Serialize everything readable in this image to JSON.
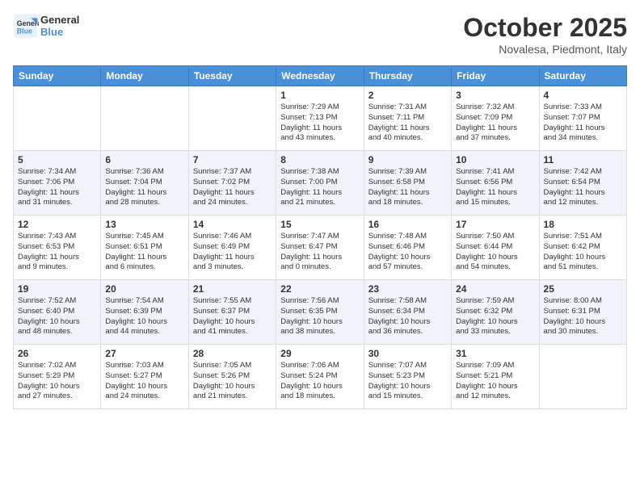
{
  "header": {
    "logo_line1": "General",
    "logo_line2": "Blue",
    "month": "October 2025",
    "location": "Novalesa, Piedmont, Italy"
  },
  "days_of_week": [
    "Sunday",
    "Monday",
    "Tuesday",
    "Wednesday",
    "Thursday",
    "Friday",
    "Saturday"
  ],
  "weeks": [
    [
      {
        "day": "",
        "info": ""
      },
      {
        "day": "",
        "info": ""
      },
      {
        "day": "",
        "info": ""
      },
      {
        "day": "1",
        "info": "Sunrise: 7:29 AM\nSunset: 7:13 PM\nDaylight: 11 hours\nand 43 minutes."
      },
      {
        "day": "2",
        "info": "Sunrise: 7:31 AM\nSunset: 7:11 PM\nDaylight: 11 hours\nand 40 minutes."
      },
      {
        "day": "3",
        "info": "Sunrise: 7:32 AM\nSunset: 7:09 PM\nDaylight: 11 hours\nand 37 minutes."
      },
      {
        "day": "4",
        "info": "Sunrise: 7:33 AM\nSunset: 7:07 PM\nDaylight: 11 hours\nand 34 minutes."
      }
    ],
    [
      {
        "day": "5",
        "info": "Sunrise: 7:34 AM\nSunset: 7:06 PM\nDaylight: 11 hours\nand 31 minutes."
      },
      {
        "day": "6",
        "info": "Sunrise: 7:36 AM\nSunset: 7:04 PM\nDaylight: 11 hours\nand 28 minutes."
      },
      {
        "day": "7",
        "info": "Sunrise: 7:37 AM\nSunset: 7:02 PM\nDaylight: 11 hours\nand 24 minutes."
      },
      {
        "day": "8",
        "info": "Sunrise: 7:38 AM\nSunset: 7:00 PM\nDaylight: 11 hours\nand 21 minutes."
      },
      {
        "day": "9",
        "info": "Sunrise: 7:39 AM\nSunset: 6:58 PM\nDaylight: 11 hours\nand 18 minutes."
      },
      {
        "day": "10",
        "info": "Sunrise: 7:41 AM\nSunset: 6:56 PM\nDaylight: 11 hours\nand 15 minutes."
      },
      {
        "day": "11",
        "info": "Sunrise: 7:42 AM\nSunset: 6:54 PM\nDaylight: 11 hours\nand 12 minutes."
      }
    ],
    [
      {
        "day": "12",
        "info": "Sunrise: 7:43 AM\nSunset: 6:53 PM\nDaylight: 11 hours\nand 9 minutes."
      },
      {
        "day": "13",
        "info": "Sunrise: 7:45 AM\nSunset: 6:51 PM\nDaylight: 11 hours\nand 6 minutes."
      },
      {
        "day": "14",
        "info": "Sunrise: 7:46 AM\nSunset: 6:49 PM\nDaylight: 11 hours\nand 3 minutes."
      },
      {
        "day": "15",
        "info": "Sunrise: 7:47 AM\nSunset: 6:47 PM\nDaylight: 11 hours\nand 0 minutes."
      },
      {
        "day": "16",
        "info": "Sunrise: 7:48 AM\nSunset: 6:46 PM\nDaylight: 10 hours\nand 57 minutes."
      },
      {
        "day": "17",
        "info": "Sunrise: 7:50 AM\nSunset: 6:44 PM\nDaylight: 10 hours\nand 54 minutes."
      },
      {
        "day": "18",
        "info": "Sunrise: 7:51 AM\nSunset: 6:42 PM\nDaylight: 10 hours\nand 51 minutes."
      }
    ],
    [
      {
        "day": "19",
        "info": "Sunrise: 7:52 AM\nSunset: 6:40 PM\nDaylight: 10 hours\nand 48 minutes."
      },
      {
        "day": "20",
        "info": "Sunrise: 7:54 AM\nSunset: 6:39 PM\nDaylight: 10 hours\nand 44 minutes."
      },
      {
        "day": "21",
        "info": "Sunrise: 7:55 AM\nSunset: 6:37 PM\nDaylight: 10 hours\nand 41 minutes."
      },
      {
        "day": "22",
        "info": "Sunrise: 7:56 AM\nSunset: 6:35 PM\nDaylight: 10 hours\nand 38 minutes."
      },
      {
        "day": "23",
        "info": "Sunrise: 7:58 AM\nSunset: 6:34 PM\nDaylight: 10 hours\nand 36 minutes."
      },
      {
        "day": "24",
        "info": "Sunrise: 7:59 AM\nSunset: 6:32 PM\nDaylight: 10 hours\nand 33 minutes."
      },
      {
        "day": "25",
        "info": "Sunrise: 8:00 AM\nSunset: 6:31 PM\nDaylight: 10 hours\nand 30 minutes."
      }
    ],
    [
      {
        "day": "26",
        "info": "Sunrise: 7:02 AM\nSunset: 5:29 PM\nDaylight: 10 hours\nand 27 minutes."
      },
      {
        "day": "27",
        "info": "Sunrise: 7:03 AM\nSunset: 5:27 PM\nDaylight: 10 hours\nand 24 minutes."
      },
      {
        "day": "28",
        "info": "Sunrise: 7:05 AM\nSunset: 5:26 PM\nDaylight: 10 hours\nand 21 minutes."
      },
      {
        "day": "29",
        "info": "Sunrise: 7:06 AM\nSunset: 5:24 PM\nDaylight: 10 hours\nand 18 minutes."
      },
      {
        "day": "30",
        "info": "Sunrise: 7:07 AM\nSunset: 5:23 PM\nDaylight: 10 hours\nand 15 minutes."
      },
      {
        "day": "31",
        "info": "Sunrise: 7:09 AM\nSunset: 5:21 PM\nDaylight: 10 hours\nand 12 minutes."
      },
      {
        "day": "",
        "info": ""
      }
    ]
  ]
}
